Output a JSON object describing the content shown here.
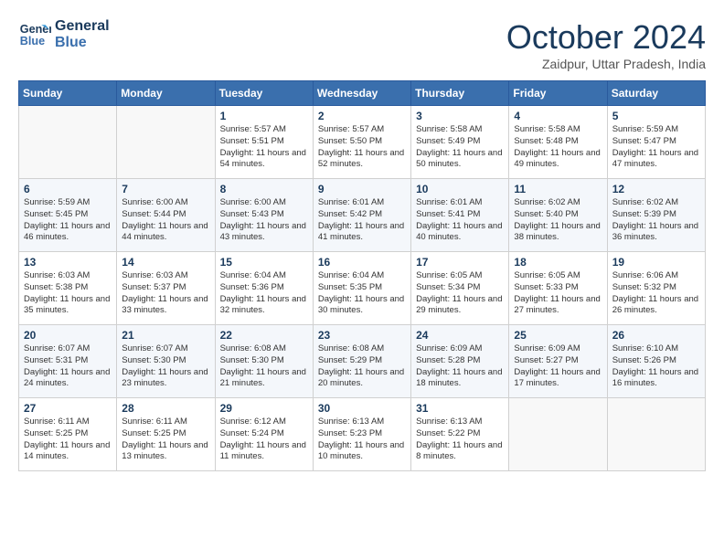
{
  "header": {
    "logo_line1": "General",
    "logo_line2": "Blue",
    "month": "October 2024",
    "location": "Zaidpur, Uttar Pradesh, India"
  },
  "days_of_week": [
    "Sunday",
    "Monday",
    "Tuesday",
    "Wednesday",
    "Thursday",
    "Friday",
    "Saturday"
  ],
  "weeks": [
    [
      {
        "day": "",
        "sunrise": "",
        "sunset": "",
        "daylight": ""
      },
      {
        "day": "",
        "sunrise": "",
        "sunset": "",
        "daylight": ""
      },
      {
        "day": "1",
        "sunrise": "Sunrise: 5:57 AM",
        "sunset": "Sunset: 5:51 PM",
        "daylight": "Daylight: 11 hours and 54 minutes."
      },
      {
        "day": "2",
        "sunrise": "Sunrise: 5:57 AM",
        "sunset": "Sunset: 5:50 PM",
        "daylight": "Daylight: 11 hours and 52 minutes."
      },
      {
        "day": "3",
        "sunrise": "Sunrise: 5:58 AM",
        "sunset": "Sunset: 5:49 PM",
        "daylight": "Daylight: 11 hours and 50 minutes."
      },
      {
        "day": "4",
        "sunrise": "Sunrise: 5:58 AM",
        "sunset": "Sunset: 5:48 PM",
        "daylight": "Daylight: 11 hours and 49 minutes."
      },
      {
        "day": "5",
        "sunrise": "Sunrise: 5:59 AM",
        "sunset": "Sunset: 5:47 PM",
        "daylight": "Daylight: 11 hours and 47 minutes."
      }
    ],
    [
      {
        "day": "6",
        "sunrise": "Sunrise: 5:59 AM",
        "sunset": "Sunset: 5:45 PM",
        "daylight": "Daylight: 11 hours and 46 minutes."
      },
      {
        "day": "7",
        "sunrise": "Sunrise: 6:00 AM",
        "sunset": "Sunset: 5:44 PM",
        "daylight": "Daylight: 11 hours and 44 minutes."
      },
      {
        "day": "8",
        "sunrise": "Sunrise: 6:00 AM",
        "sunset": "Sunset: 5:43 PM",
        "daylight": "Daylight: 11 hours and 43 minutes."
      },
      {
        "day": "9",
        "sunrise": "Sunrise: 6:01 AM",
        "sunset": "Sunset: 5:42 PM",
        "daylight": "Daylight: 11 hours and 41 minutes."
      },
      {
        "day": "10",
        "sunrise": "Sunrise: 6:01 AM",
        "sunset": "Sunset: 5:41 PM",
        "daylight": "Daylight: 11 hours and 40 minutes."
      },
      {
        "day": "11",
        "sunrise": "Sunrise: 6:02 AM",
        "sunset": "Sunset: 5:40 PM",
        "daylight": "Daylight: 11 hours and 38 minutes."
      },
      {
        "day": "12",
        "sunrise": "Sunrise: 6:02 AM",
        "sunset": "Sunset: 5:39 PM",
        "daylight": "Daylight: 11 hours and 36 minutes."
      }
    ],
    [
      {
        "day": "13",
        "sunrise": "Sunrise: 6:03 AM",
        "sunset": "Sunset: 5:38 PM",
        "daylight": "Daylight: 11 hours and 35 minutes."
      },
      {
        "day": "14",
        "sunrise": "Sunrise: 6:03 AM",
        "sunset": "Sunset: 5:37 PM",
        "daylight": "Daylight: 11 hours and 33 minutes."
      },
      {
        "day": "15",
        "sunrise": "Sunrise: 6:04 AM",
        "sunset": "Sunset: 5:36 PM",
        "daylight": "Daylight: 11 hours and 32 minutes."
      },
      {
        "day": "16",
        "sunrise": "Sunrise: 6:04 AM",
        "sunset": "Sunset: 5:35 PM",
        "daylight": "Daylight: 11 hours and 30 minutes."
      },
      {
        "day": "17",
        "sunrise": "Sunrise: 6:05 AM",
        "sunset": "Sunset: 5:34 PM",
        "daylight": "Daylight: 11 hours and 29 minutes."
      },
      {
        "day": "18",
        "sunrise": "Sunrise: 6:05 AM",
        "sunset": "Sunset: 5:33 PM",
        "daylight": "Daylight: 11 hours and 27 minutes."
      },
      {
        "day": "19",
        "sunrise": "Sunrise: 6:06 AM",
        "sunset": "Sunset: 5:32 PM",
        "daylight": "Daylight: 11 hours and 26 minutes."
      }
    ],
    [
      {
        "day": "20",
        "sunrise": "Sunrise: 6:07 AM",
        "sunset": "Sunset: 5:31 PM",
        "daylight": "Daylight: 11 hours and 24 minutes."
      },
      {
        "day": "21",
        "sunrise": "Sunrise: 6:07 AM",
        "sunset": "Sunset: 5:30 PM",
        "daylight": "Daylight: 11 hours and 23 minutes."
      },
      {
        "day": "22",
        "sunrise": "Sunrise: 6:08 AM",
        "sunset": "Sunset: 5:30 PM",
        "daylight": "Daylight: 11 hours and 21 minutes."
      },
      {
        "day": "23",
        "sunrise": "Sunrise: 6:08 AM",
        "sunset": "Sunset: 5:29 PM",
        "daylight": "Daylight: 11 hours and 20 minutes."
      },
      {
        "day": "24",
        "sunrise": "Sunrise: 6:09 AM",
        "sunset": "Sunset: 5:28 PM",
        "daylight": "Daylight: 11 hours and 18 minutes."
      },
      {
        "day": "25",
        "sunrise": "Sunrise: 6:09 AM",
        "sunset": "Sunset: 5:27 PM",
        "daylight": "Daylight: 11 hours and 17 minutes."
      },
      {
        "day": "26",
        "sunrise": "Sunrise: 6:10 AM",
        "sunset": "Sunset: 5:26 PM",
        "daylight": "Daylight: 11 hours and 16 minutes."
      }
    ],
    [
      {
        "day": "27",
        "sunrise": "Sunrise: 6:11 AM",
        "sunset": "Sunset: 5:25 PM",
        "daylight": "Daylight: 11 hours and 14 minutes."
      },
      {
        "day": "28",
        "sunrise": "Sunrise: 6:11 AM",
        "sunset": "Sunset: 5:25 PM",
        "daylight": "Daylight: 11 hours and 13 minutes."
      },
      {
        "day": "29",
        "sunrise": "Sunrise: 6:12 AM",
        "sunset": "Sunset: 5:24 PM",
        "daylight": "Daylight: 11 hours and 11 minutes."
      },
      {
        "day": "30",
        "sunrise": "Sunrise: 6:13 AM",
        "sunset": "Sunset: 5:23 PM",
        "daylight": "Daylight: 11 hours and 10 minutes."
      },
      {
        "day": "31",
        "sunrise": "Sunrise: 6:13 AM",
        "sunset": "Sunset: 5:22 PM",
        "daylight": "Daylight: 11 hours and 8 minutes."
      },
      {
        "day": "",
        "sunrise": "",
        "sunset": "",
        "daylight": ""
      },
      {
        "day": "",
        "sunrise": "",
        "sunset": "",
        "daylight": ""
      }
    ]
  ]
}
